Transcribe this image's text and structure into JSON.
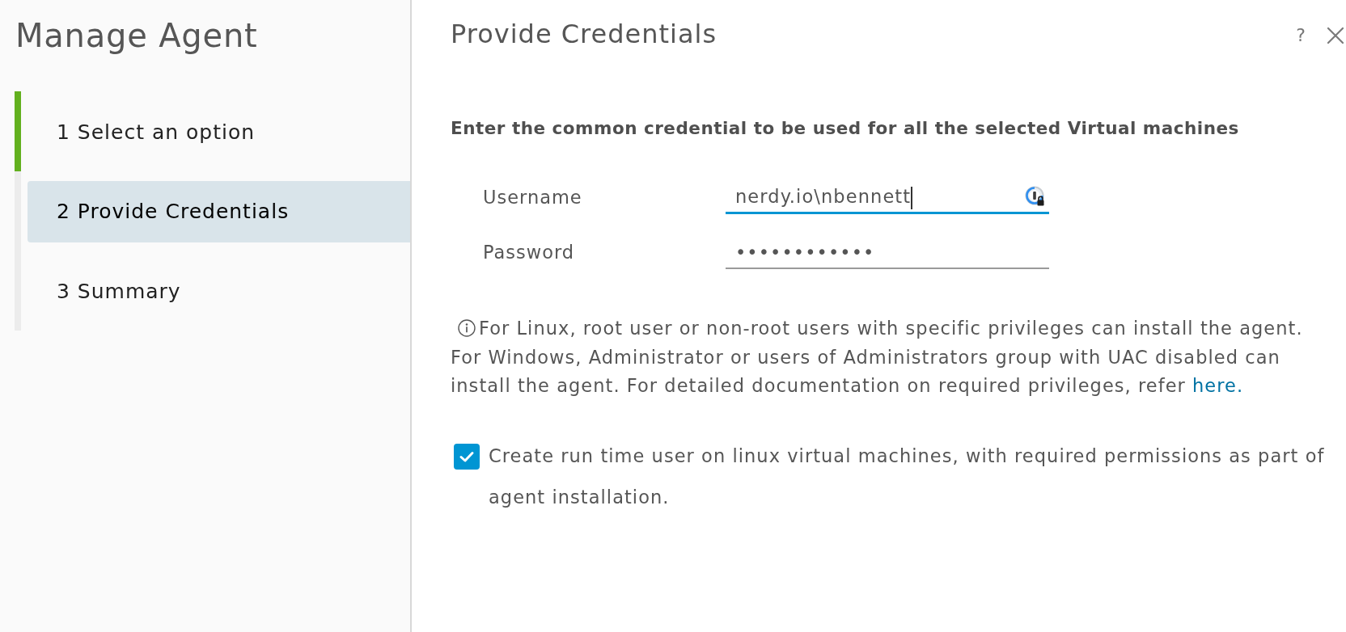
{
  "sidebar": {
    "title": "Manage Agent",
    "steps": [
      {
        "number": "1",
        "label": "Select an option",
        "selected": false,
        "completed": true
      },
      {
        "number": "2",
        "label": "Provide Credentials",
        "selected": true,
        "completed": false
      },
      {
        "number": "3",
        "label": "Summary",
        "selected": false,
        "completed": false
      }
    ]
  },
  "dialog": {
    "title": "Provide Credentials",
    "help_button": "?",
    "instruction": "Enter the common credential to be used for all the selected Virtual machines",
    "fields": [
      {
        "label": "Username",
        "value": "nerdy.io\\nbennett",
        "focused": true
      },
      {
        "label": "Password",
        "value": "••••••••••••",
        "focused": false
      }
    ],
    "info": {
      "linux_note": "For Linux, root user or non-root users with specific privileges can install the agent.",
      "windows_note": "For Windows, Administrator or users of Administrators group with UAC disabled can install the agent. For detailed documentation on required privileges, refer ",
      "link": "here."
    },
    "option": {
      "label": "Create run time user on linux virtual machines, with required permissions as part of agent installation.",
      "checked": true
    }
  }
}
